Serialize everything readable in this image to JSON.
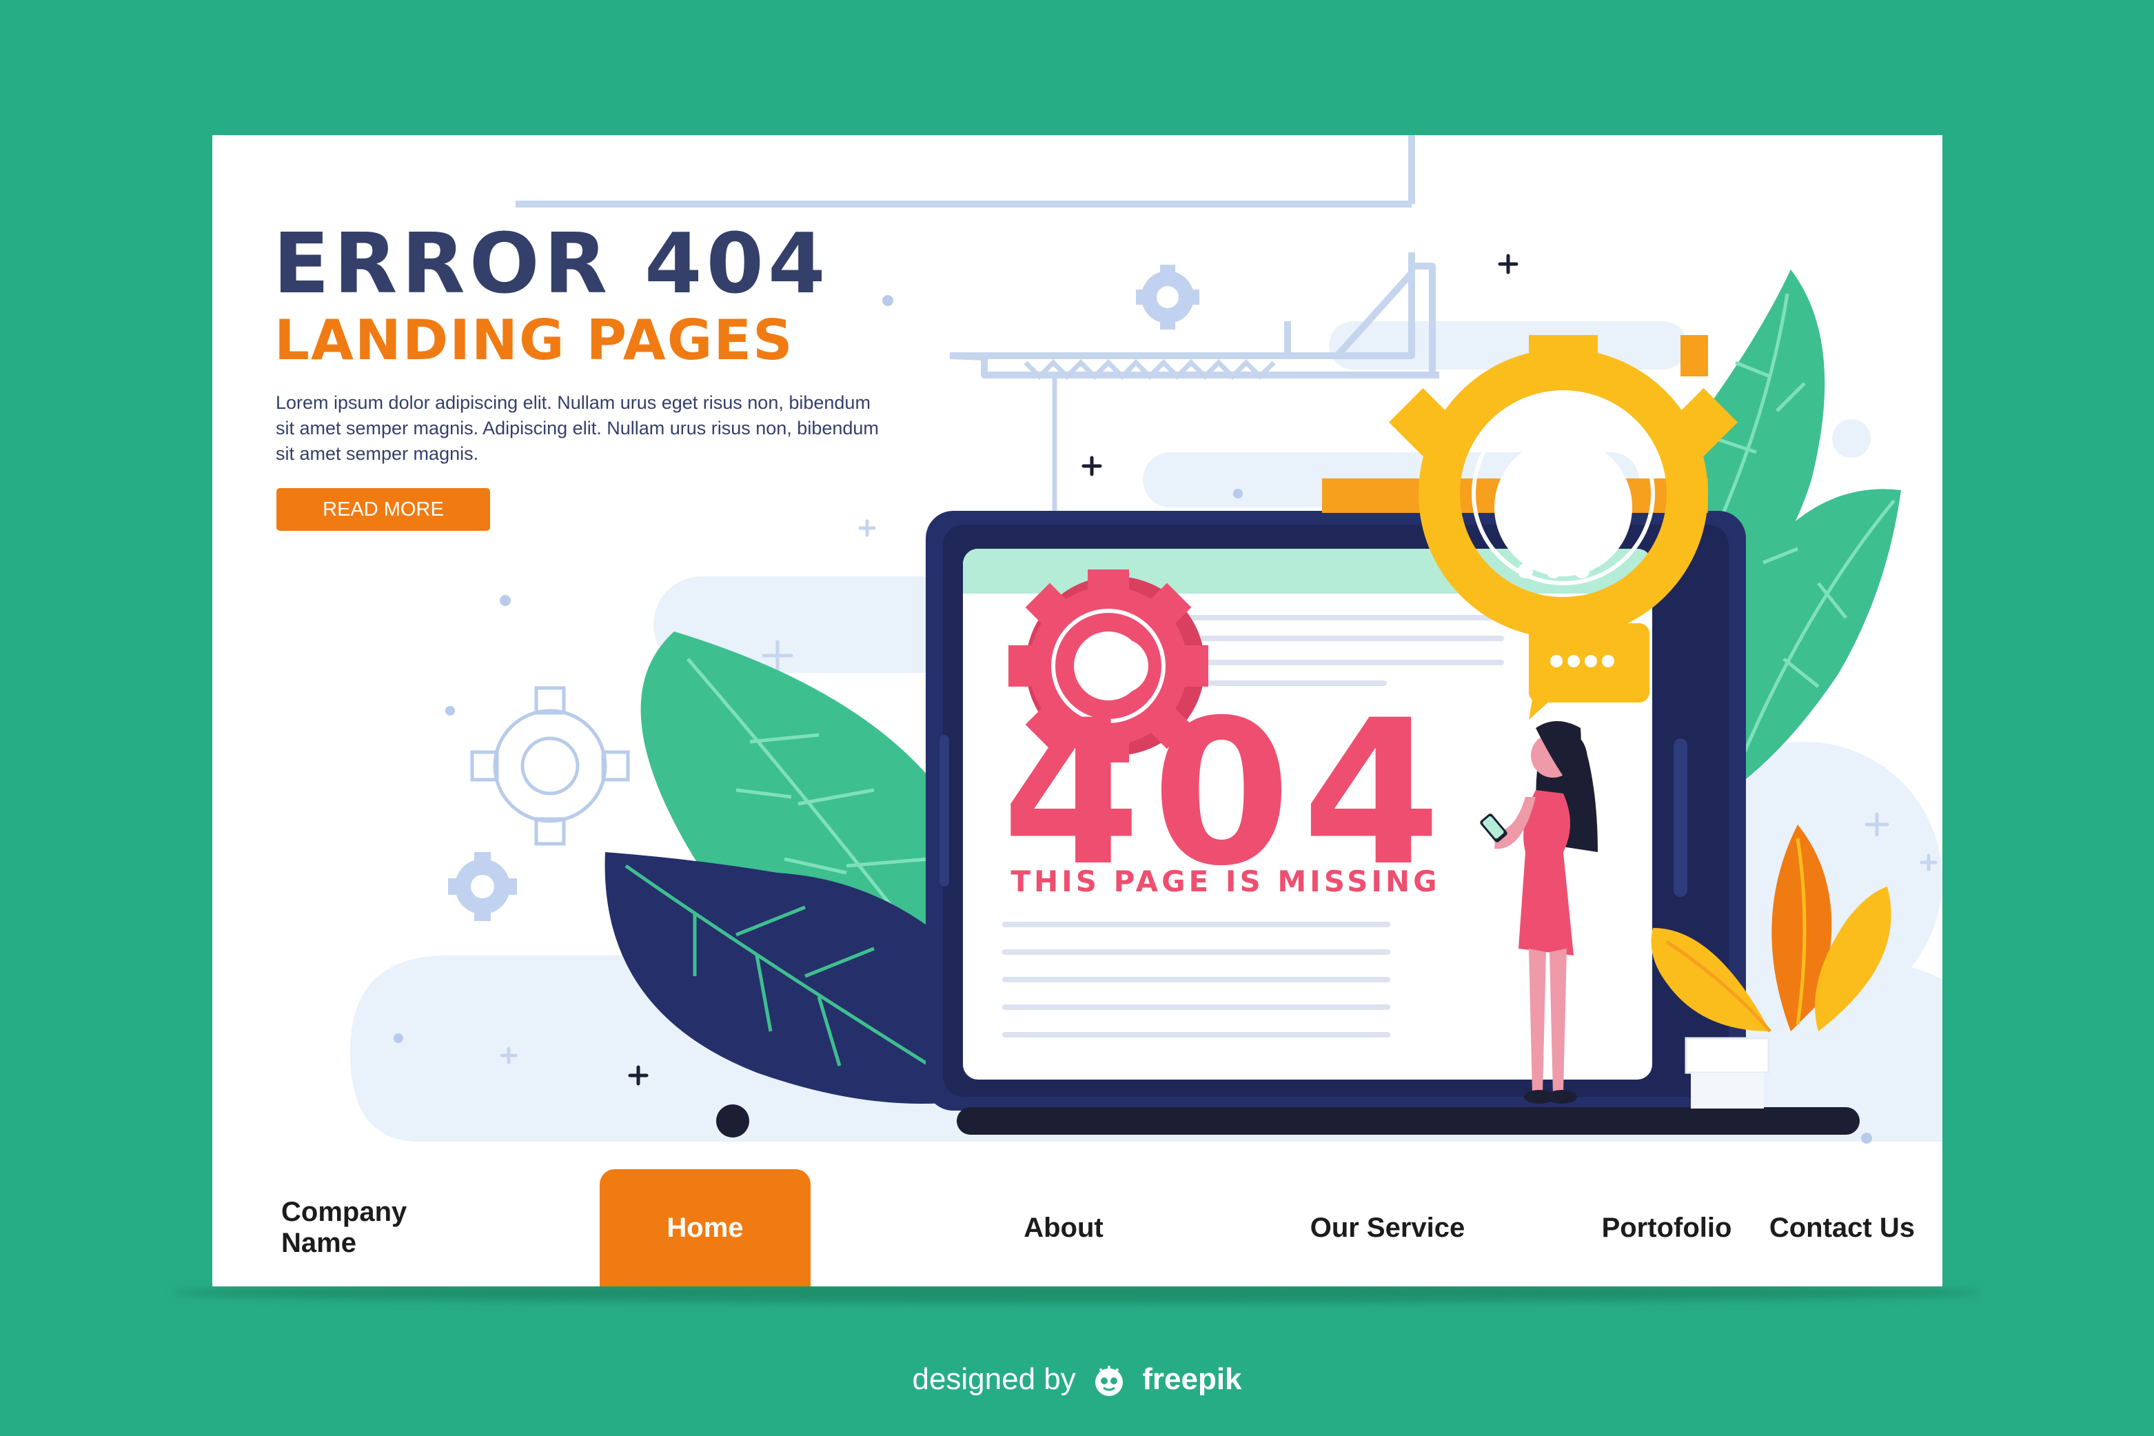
{
  "hero": {
    "title": "ERROR 404",
    "subtitle": "LANDING PAGES",
    "description": "Lorem ipsum dolor  adipiscing elit. Nullam urus eget risus non, bibendum sit amet semper magnis. Adipiscing elit. Nullam urus risus non, bibendum sit amet semper magnis.",
    "button_label": "READ MORE"
  },
  "illustration": {
    "code": "404",
    "message": "THIS PAGE IS MISSING"
  },
  "nav": {
    "company": "Company Name",
    "items": [
      {
        "label": "Home",
        "active": true
      },
      {
        "label": "About",
        "active": false
      },
      {
        "label": "Our Service",
        "active": false
      },
      {
        "label": "Portofolio",
        "active": false
      },
      {
        "label": "Contact Us",
        "active": false
      }
    ]
  },
  "footer": {
    "prefix": "designed by",
    "brand": "freepik"
  },
  "colors": {
    "background": "#27ad85",
    "navy": "#34406a",
    "orange": "#f07b13",
    "pink": "#ee4f70",
    "yellow": "#fbbd1c",
    "leaf_green": "#3ebf8f"
  }
}
